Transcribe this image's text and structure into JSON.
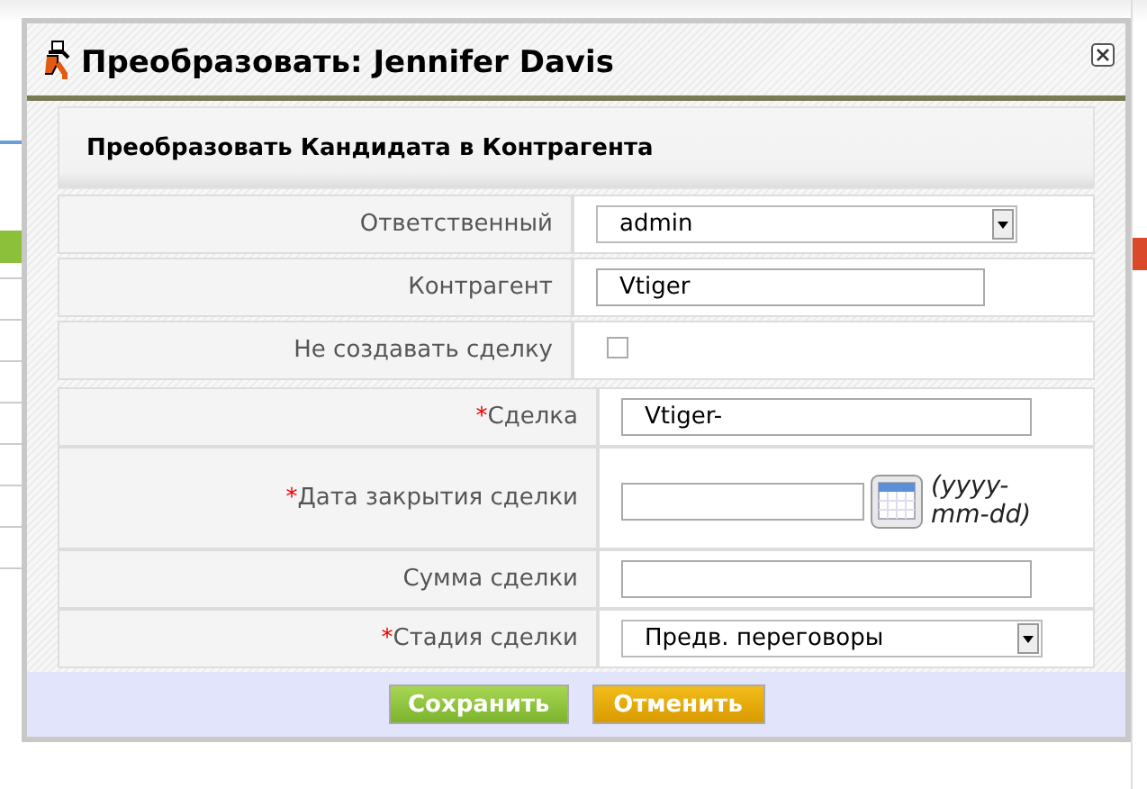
{
  "dialog": {
    "title": "Преобразовать: Jennifer Davis",
    "section_title": "Преобразовать Кандидата в Контрагента",
    "rows": [
      {
        "kind": "select",
        "label": "Ответственный",
        "value": "admin"
      },
      {
        "kind": "text",
        "label": "Контрагент",
        "value": "Vtiger"
      },
      {
        "kind": "checkbox",
        "label": "Не создавать сделку",
        "checked": false
      }
    ],
    "deal_rows": [
      {
        "kind": "text",
        "required_mark": "*",
        "label": "Сделка",
        "value": "Vtiger-"
      },
      {
        "kind": "date",
        "required_mark": "*",
        "label": "Дата закрытия сделки",
        "hint": "(yyyy-mm-dd)"
      },
      {
        "kind": "text",
        "label": "Сумма сделки"
      },
      {
        "kind": "select",
        "required_mark": "*",
        "label": "Стадия сделки",
        "value": "Предв. переговоры"
      }
    ],
    "buttons": [
      {
        "label": "Сохранить",
        "kind": "primary"
      },
      {
        "label": "Отменить",
        "kind": "secondary"
      }
    ]
  }
}
